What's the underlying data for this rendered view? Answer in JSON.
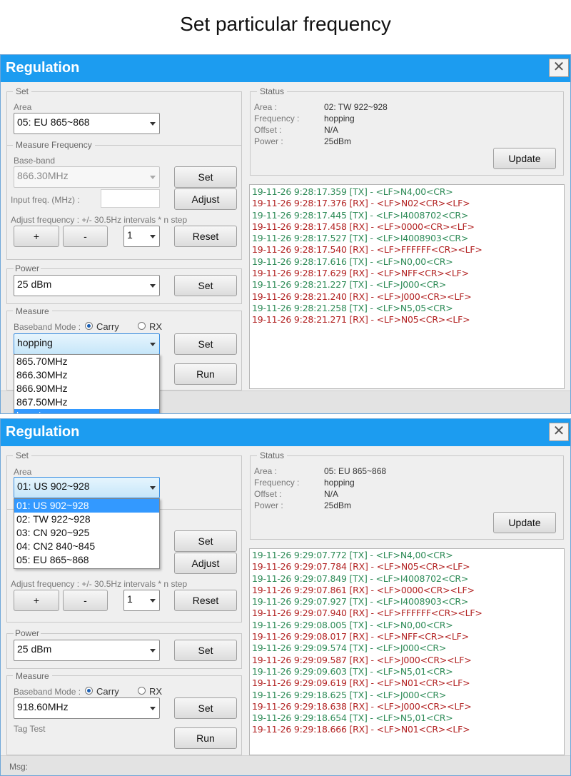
{
  "page_title": "Set particular frequency",
  "windows": [
    {
      "title": "Regulation",
      "set_label": "Set",
      "area_label": "Area",
      "area_value": "05: EU 865~868",
      "measure_freq_label": "Measure Frequency",
      "baseband_label": "Base-band",
      "baseband_value": "866.30MHz",
      "set_btn": "Set",
      "input_freq_label": "Input freq. (MHz) :",
      "adjust_btn": "Adjust",
      "adjust_freq_label": "Adjust frequency : +/- 30.5Hz intervals * n step",
      "plus_btn": "+",
      "minus_btn": "-",
      "step_value": "1",
      "reset_btn": "Reset",
      "power_label": "Power",
      "power_value": "25 dBm",
      "power_set_btn": "Set",
      "measure_label": "Measure",
      "baseband_mode_label": "Baseband Mode :",
      "carry_label": "Carry",
      "rx_label": "RX",
      "measure_value": "hopping",
      "measure_set_btn": "Set",
      "run_btn": "Run",
      "dropdown_items": [
        "865.70MHz",
        "866.30MHz",
        "866.90MHz",
        "867.50MHz",
        "hopping"
      ],
      "status_label": "Status",
      "status": {
        "area_k": "Area :",
        "area_v": "02: TW 922~928",
        "freq_k": "Frequency :",
        "freq_v": "hopping",
        "offset_k": "Offset :",
        "offset_v": "N/A",
        "power_k": "Power :",
        "power_v": "25dBm"
      },
      "update_btn": "Update",
      "log": [
        {
          "t": "tx",
          "text": "19-11-26 9:28:17.359 [TX] - <LF>N4,00<CR>"
        },
        {
          "t": "rx",
          "text": "19-11-26 9:28:17.376 [RX] - <LF>N02<CR><LF>"
        },
        {
          "t": "tx",
          "text": "19-11-26 9:28:17.445 [TX] - <LF>I4008702<CR>"
        },
        {
          "t": "rx",
          "text": "19-11-26 9:28:17.458 [RX] - <LF>0000<CR><LF>"
        },
        {
          "t": "tx",
          "text": "19-11-26 9:28:17.527 [TX] - <LF>I4008903<CR>"
        },
        {
          "t": "rx",
          "text": "19-11-26 9:28:17.540 [RX] - <LF>FFFFFF<CR><LF>"
        },
        {
          "t": "tx",
          "text": "19-11-26 9:28:17.616 [TX] - <LF>N0,00<CR>"
        },
        {
          "t": "rx",
          "text": "19-11-26 9:28:17.629 [RX] - <LF>NFF<CR><LF>"
        },
        {
          "t": "tx",
          "text": "19-11-26 9:28:21.227 [TX] - <LF>J000<CR>"
        },
        {
          "t": "rx",
          "text": "19-11-26 9:28:21.240 [RX] - <LF>J000<CR><LF>"
        },
        {
          "t": "tx",
          "text": "19-11-26 9:28:21.258 [TX] - <LF>N5,05<CR>"
        },
        {
          "t": "rx",
          "text": "19-11-26 9:28:21.271 [RX] - <LF>N05<CR><LF>"
        }
      ]
    },
    {
      "title": "Regulation",
      "set_label": "Set",
      "area_label": "Area",
      "area_value": "01: US 902~928",
      "set_btn": "Set",
      "adjust_btn": "Adjust",
      "adjust_freq_label": "Adjust frequency : +/- 30.5Hz intervals * n step",
      "plus_btn": "+",
      "minus_btn": "-",
      "step_value": "1",
      "reset_btn": "Reset",
      "power_label": "Power",
      "power_value": "25 dBm",
      "power_set_btn": "Set",
      "measure_label": "Measure",
      "baseband_mode_label": "Baseband Mode :",
      "carry_label": "Carry",
      "rx_label": "RX",
      "measure_value": "918.60MHz",
      "measure_set_btn": "Set",
      "tag_test_label": "Tag Test",
      "run_btn": "Run",
      "dropdown_items": [
        "01: US 902~928",
        "02: TW 922~928",
        "03: CN 920~925",
        "04: CN2 840~845",
        "05: EU 865~868"
      ],
      "status_label": "Status",
      "status": {
        "area_k": "Area :",
        "area_v": "05: EU 865~868",
        "freq_k": "Frequency :",
        "freq_v": "hopping",
        "offset_k": "Offset :",
        "offset_v": "N/A",
        "power_k": "Power :",
        "power_v": "25dBm"
      },
      "update_btn": "Update",
      "msg_label": "Msg:",
      "log": [
        {
          "t": "tx",
          "text": "19-11-26 9:29:07.772 [TX] - <LF>N4,00<CR>"
        },
        {
          "t": "rx",
          "text": "19-11-26 9:29:07.784 [RX] - <LF>N05<CR><LF>"
        },
        {
          "t": "tx",
          "text": "19-11-26 9:29:07.849 [TX] - <LF>I4008702<CR>"
        },
        {
          "t": "rx",
          "text": "19-11-26 9:29:07.861 [RX] - <LF>0000<CR><LF>"
        },
        {
          "t": "tx",
          "text": "19-11-26 9:29:07.927 [TX] - <LF>I4008903<CR>"
        },
        {
          "t": "rx",
          "text": "19-11-26 9:29:07.940 [RX] - <LF>FFFFFF<CR><LF>"
        },
        {
          "t": "tx",
          "text": "19-11-26 9:29:08.005 [TX] - <LF>N0,00<CR>"
        },
        {
          "t": "rx",
          "text": "19-11-26 9:29:08.017 [RX] - <LF>NFF<CR><LF>"
        },
        {
          "t": "tx",
          "text": "19-11-26 9:29:09.574 [TX] - <LF>J000<CR>"
        },
        {
          "t": "rx",
          "text": "19-11-26 9:29:09.587 [RX] - <LF>J000<CR><LF>"
        },
        {
          "t": "tx",
          "text": "19-11-26 9:29:09.603 [TX] - <LF>N5,01<CR>"
        },
        {
          "t": "rx",
          "text": "19-11-26 9:29:09.619 [RX] - <LF>N01<CR><LF>"
        },
        {
          "t": "tx",
          "text": "19-11-26 9:29:18.625 [TX] - <LF>J000<CR>"
        },
        {
          "t": "rx",
          "text": "19-11-26 9:29:18.638 [RX] - <LF>J000<CR><LF>"
        },
        {
          "t": "tx",
          "text": "19-11-26 9:29:18.654 [TX] - <LF>N5,01<CR>"
        },
        {
          "t": "rx",
          "text": "19-11-26 9:29:18.666 [RX] - <LF>N01<CR><LF>"
        }
      ]
    }
  ],
  "colors": {
    "titlebar": "#1c9cf0",
    "tx": "#2e8b57",
    "rx": "#b22222",
    "selected": "#3399ff"
  }
}
